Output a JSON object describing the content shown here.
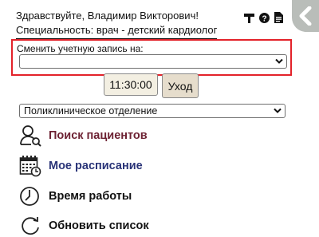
{
  "header": {
    "greeting": "Здравствуйте, Владимир Викторович!",
    "specialty": "Специальность: врач - детский кардиолог"
  },
  "header_icons": [
    "filter-icon",
    "help-icon",
    "document-icon"
  ],
  "account_switch": {
    "label": "Сменить учетную запись на:",
    "selected": ""
  },
  "session": {
    "time": "11:30:00",
    "exit_label": "Уход"
  },
  "department": {
    "selected": "Поликлиническое отделение"
  },
  "menu": [
    {
      "label": "Поиск пациентов",
      "icon": "patient-search-icon",
      "color": "#6d2233"
    },
    {
      "label": "Мое расписание",
      "icon": "calendar-icon",
      "color": "#2a3478"
    },
    {
      "label": "Время работы",
      "icon": "clock-icon",
      "color": "#111111"
    },
    {
      "label": "Обновить список",
      "icon": "refresh-icon",
      "color": "#111111"
    }
  ],
  "colors": {
    "highlight_border": "#e3222a",
    "collapse_tab": "#b9bdb9",
    "time_button_bg": "#f3efe2",
    "exit_button_bg": "#e6ddcc"
  }
}
